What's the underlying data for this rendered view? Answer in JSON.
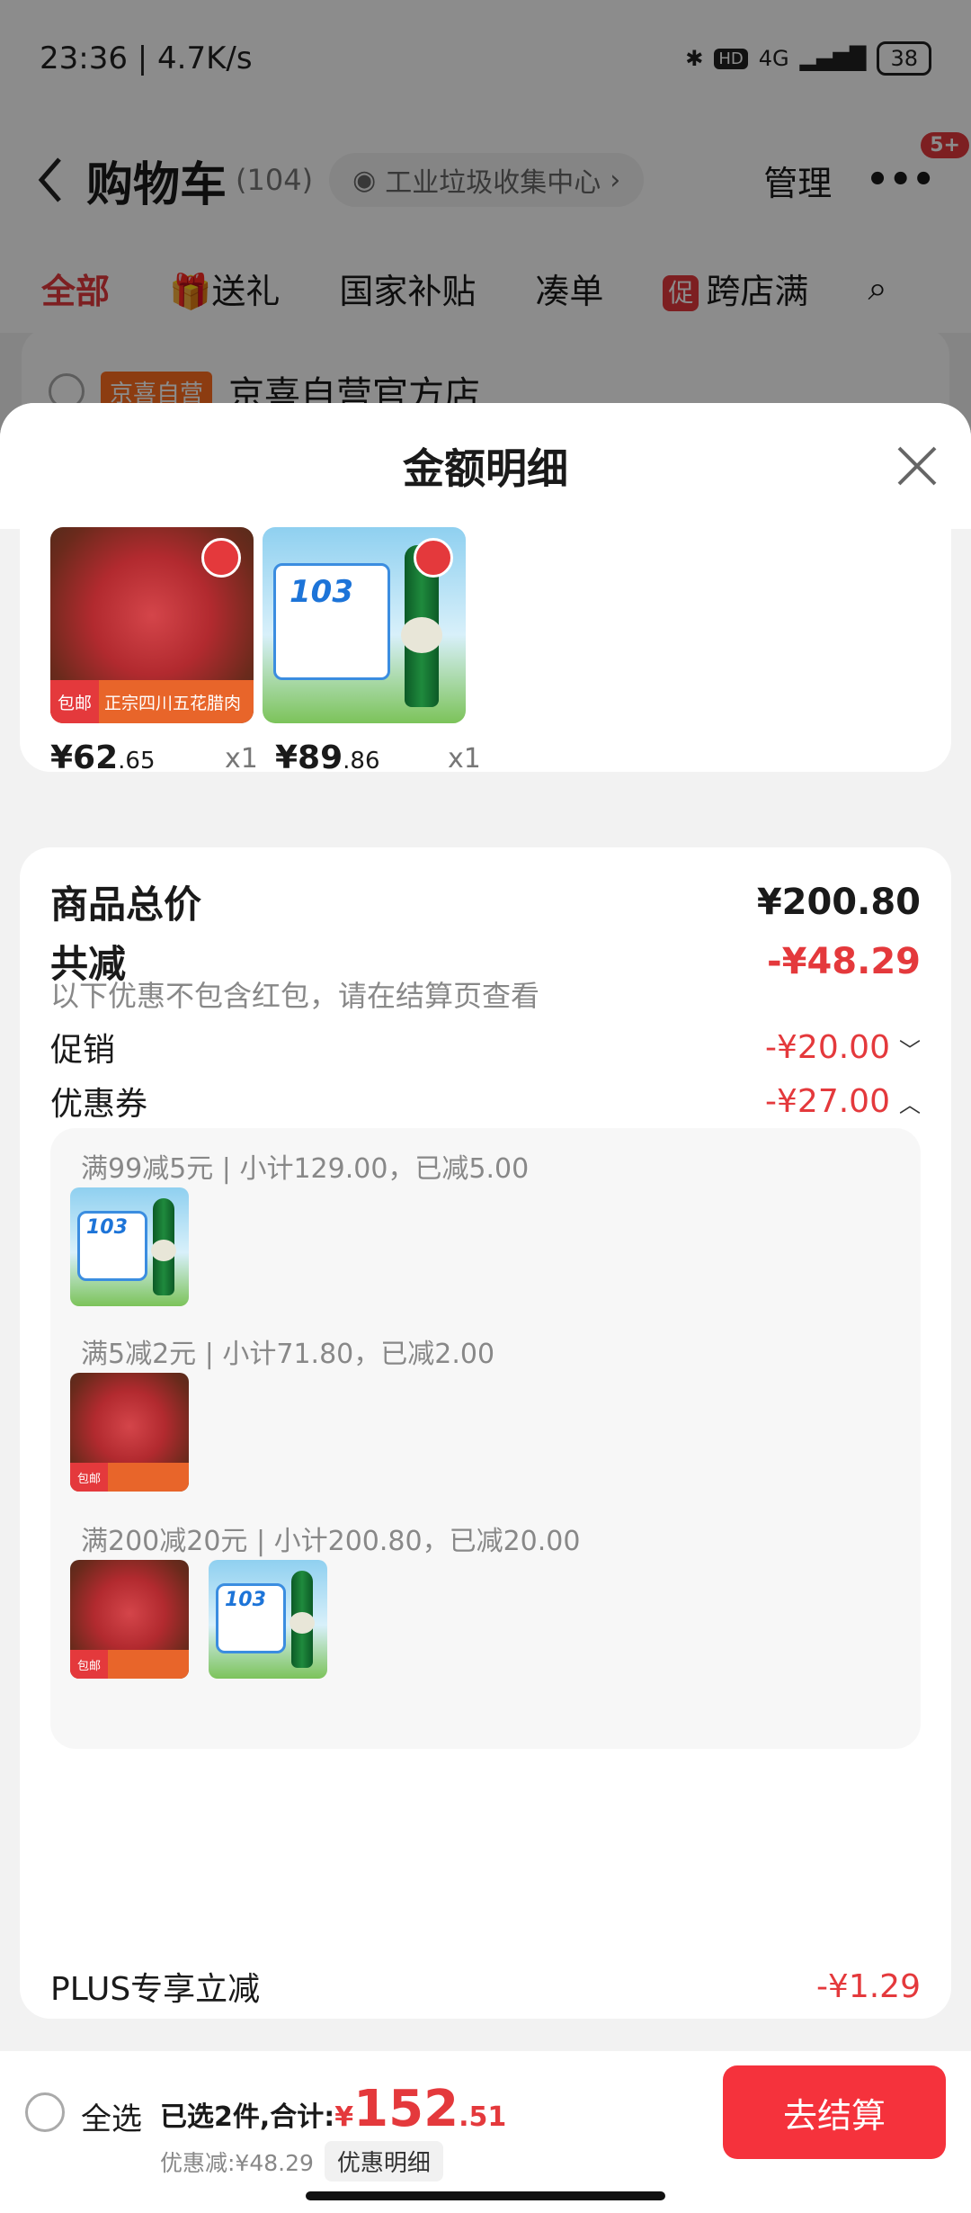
{
  "status": {
    "time": "23:36 | 4.7K/s",
    "network": "4G",
    "hd": "HD",
    "battery": "38"
  },
  "header": {
    "back_icon": "chevron-left-icon",
    "title": "购物车",
    "count": "(104)",
    "location": "工业垃圾收集中心",
    "manage": "管理",
    "more_badge": "5+"
  },
  "tabs": [
    {
      "label": "全部"
    },
    {
      "label": "送礼"
    },
    {
      "label": "国家补贴"
    },
    {
      "label": "凑单"
    },
    {
      "label": "跨店满"
    }
  ],
  "tab_icon_promo": "促",
  "shop": {
    "tag": "京喜自营",
    "name": "京喜自营官方店"
  },
  "sheet": {
    "title": "金额明细"
  },
  "products": [
    {
      "ribbon_left": "包邮",
      "ribbon_right": "正宗四川五花腊肉",
      "price_int": "¥62",
      "price_dec": ".65",
      "qty": "x1"
    },
    {
      "badge_num": "103",
      "price_int": "¥89",
      "price_dec": ".86",
      "qty": "x1"
    }
  ],
  "detail": {
    "subtotal_label": "商品总价",
    "subtotal_value": "¥200.80",
    "discount_label": "共减",
    "discount_value": "-¥48.29",
    "discount_note": "以下优惠不包含红包，请在结算页查看",
    "promo_label": "促销",
    "promo_value": "-¥20.00",
    "coupon_label": "优惠券",
    "coupon_value": "-¥27.00",
    "coupon_lines": [
      "满99减5元 | 小计129.00，已减5.00",
      "满5减2元 | 小计71.80，已减2.00",
      "满200减20元 | 小计200.80，已减20.00"
    ],
    "plus_label": "PLUS专享立减",
    "plus_value": "-¥1.29"
  },
  "bottom": {
    "select_all": "全选",
    "selected_text": "已选2件,合计:",
    "currency": "¥",
    "total_int": "152",
    "total_dec": ".51",
    "saved_text": "优惠减:¥48.29",
    "detail_pill": "优惠明细",
    "checkout": "去结算"
  },
  "colors": {
    "accent": "#e4393c",
    "checkout": "#f5323c"
  }
}
